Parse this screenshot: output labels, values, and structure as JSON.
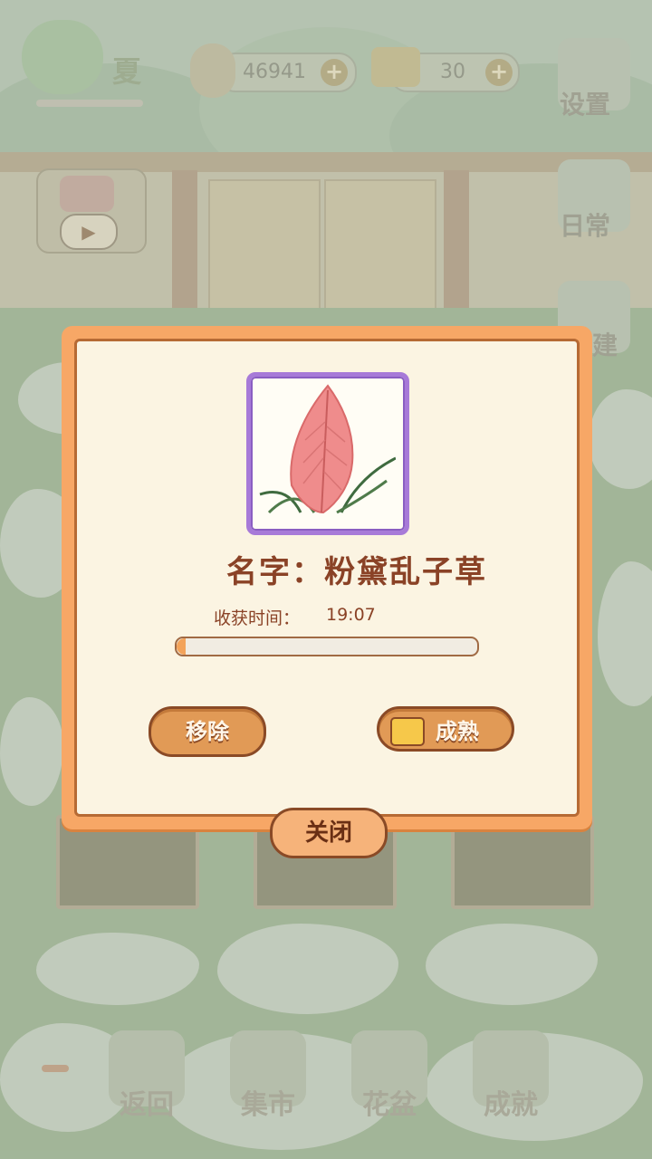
{
  "topbar": {
    "season": "夏",
    "fish_count": "46941",
    "cheese_count": "30",
    "plus": "+"
  },
  "side_menu": {
    "settings": "设置",
    "daily": "日常",
    "build": "建"
  },
  "bottom_nav": [
    {
      "label": "返回"
    },
    {
      "label": "集市"
    },
    {
      "label": "花盆"
    },
    {
      "label": "成就"
    }
  ],
  "dialog": {
    "plant_name": "名字：粉黛乱子草",
    "harvest_label": "收获时间：",
    "harvest_time": "19:07",
    "progress": 0.03,
    "remove_button": "移除",
    "ripen_button": "成熟",
    "close_button": "关闭"
  },
  "colors": {
    "dialog_border": "#f7a766",
    "frame_purple": "#a77ad8",
    "text_brown": "#8a4226"
  }
}
